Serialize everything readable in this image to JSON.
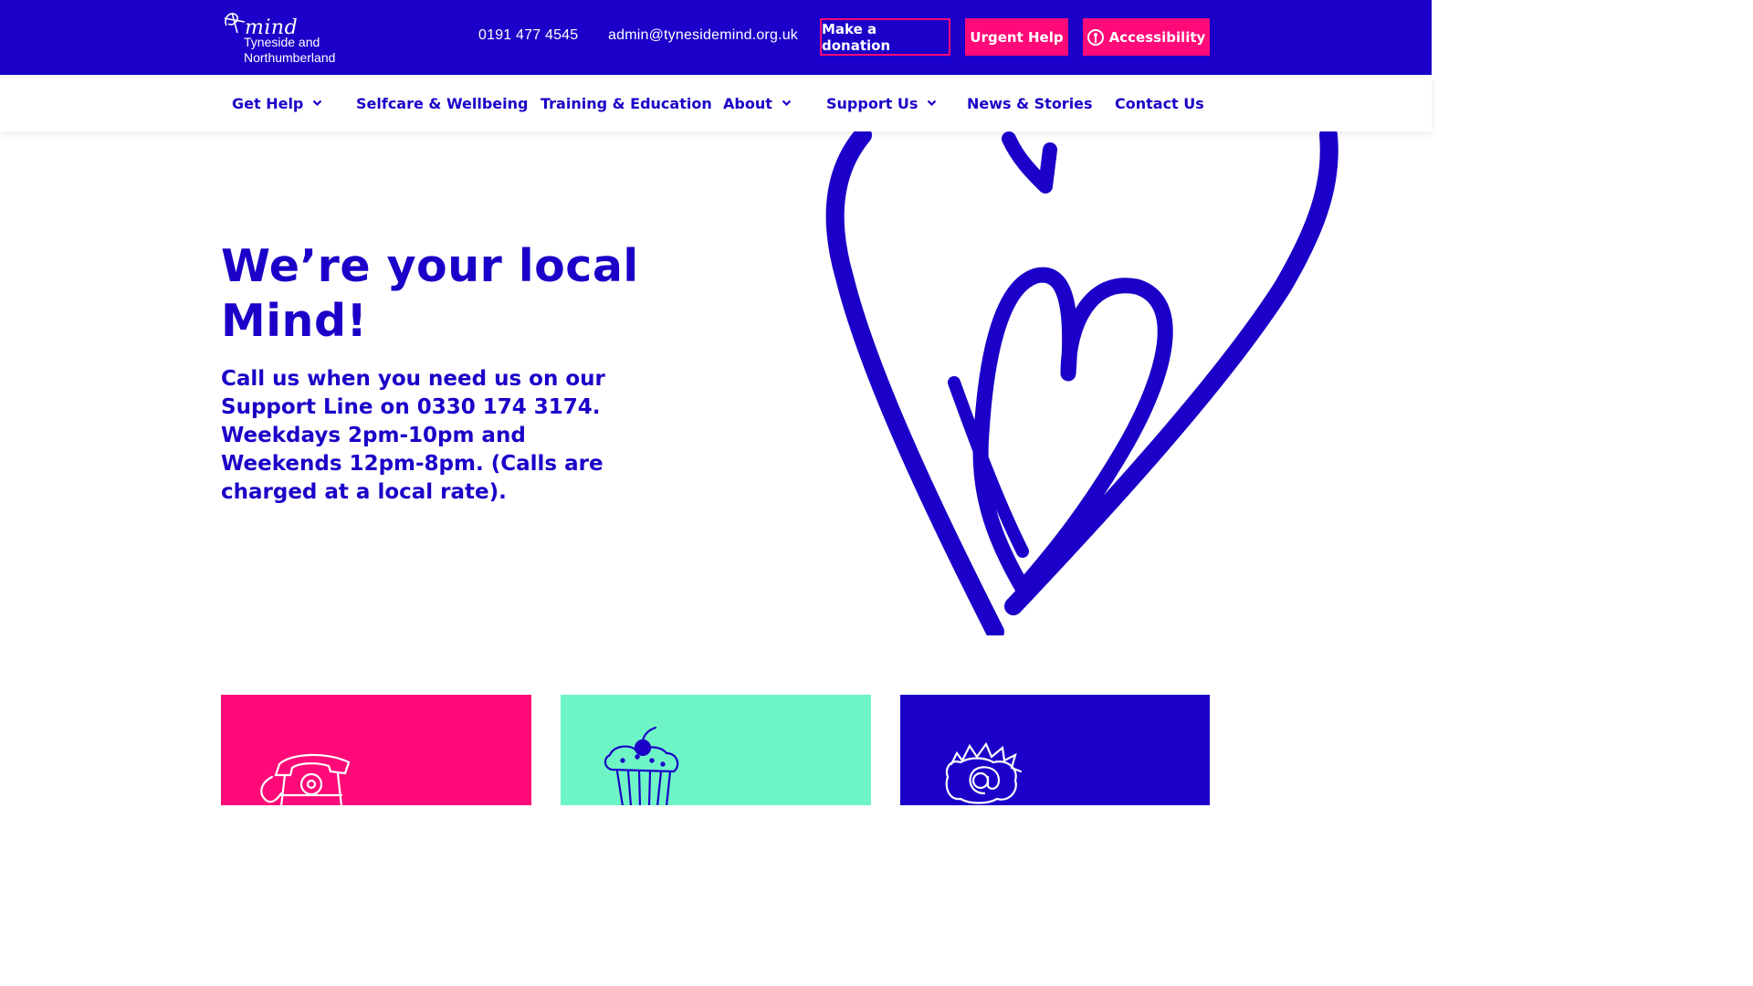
{
  "header": {
    "logo": {
      "wordmark": "mind",
      "subtitle_line1": "Tyneside and",
      "subtitle_line2": "Northumberland"
    },
    "phone": "0191 477 4545",
    "email": "admin@tynesidemind.org.uk",
    "buttons": {
      "donate": "Make a donation",
      "urgent": "Urgent Help",
      "accessibility": "Accessibility"
    }
  },
  "nav": {
    "items": [
      {
        "label": "Get Help",
        "has_dropdown": true
      },
      {
        "label": "Selfcare & Wellbeing",
        "has_dropdown": false
      },
      {
        "label": "Training & Education",
        "has_dropdown": false
      },
      {
        "label": "About",
        "has_dropdown": true
      },
      {
        "label": "Support Us",
        "has_dropdown": true
      },
      {
        "label": "News & Stories",
        "has_dropdown": false
      },
      {
        "label": "Contact Us",
        "has_dropdown": false
      }
    ]
  },
  "hero": {
    "title_line1": "We’re your local",
    "title_line2": "Mind!",
    "text": "Call us when you need us on our Support Line on 0330 174 3174. Weekdays 2pm-10pm and Weekends 12pm-8pm. (Calls are charged at a local rate)."
  },
  "cards": [
    {
      "icon": "telephone-icon",
      "color": "#ff0a78"
    },
    {
      "icon": "cupcake-icon",
      "color": "#6ef5c6"
    },
    {
      "icon": "at-sign-icon",
      "color": "#1a00c8"
    }
  ],
  "colors": {
    "brand_blue": "#1a00c8",
    "accent_pink": "#ff0a78",
    "mint": "#6ef5c6",
    "white": "#ffffff"
  }
}
